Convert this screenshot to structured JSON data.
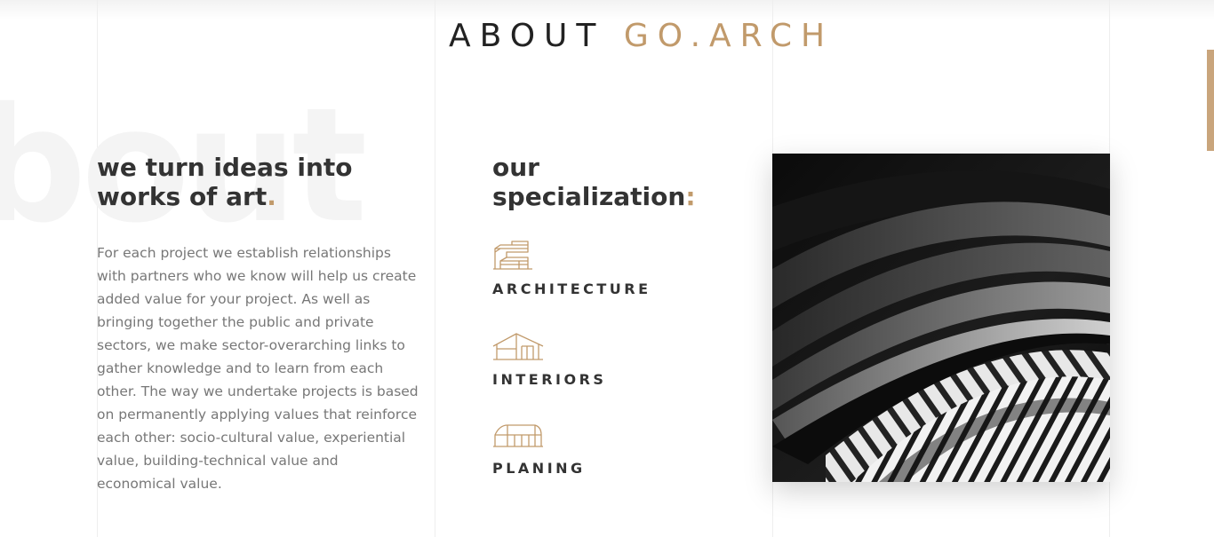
{
  "section": {
    "title_main": "ABOUT",
    "title_accent": "GO.ARCH",
    "background_word": "bout"
  },
  "about": {
    "headline": "we turn ideas into works of art",
    "headline_dot": ".",
    "body": "For each project we establish relationships with partners who we know will help us create added value for your project. As well as bringing together the public and private sectors, we make sector-overarching links to gather knowledge and to learn from each other. The way we undertake projects is based on permanently applying values that reinforce each other: socio-cultural value, experiential value, building-technical value and economical value."
  },
  "specialization": {
    "heading_line1": "our",
    "heading_line2": "specialization",
    "heading_colon": ":",
    "items": [
      {
        "label": "ARCHITECTURE",
        "icon": "building-outline-icon"
      },
      {
        "label": "INTERIORS",
        "icon": "house-outline-icon"
      },
      {
        "label": "PLANING",
        "icon": "hangar-outline-icon"
      }
    ]
  },
  "colors": {
    "accent": "#c19a6b",
    "heading": "#333333",
    "body_text": "#777777",
    "scroll_indicator": "#c9a57c"
  }
}
